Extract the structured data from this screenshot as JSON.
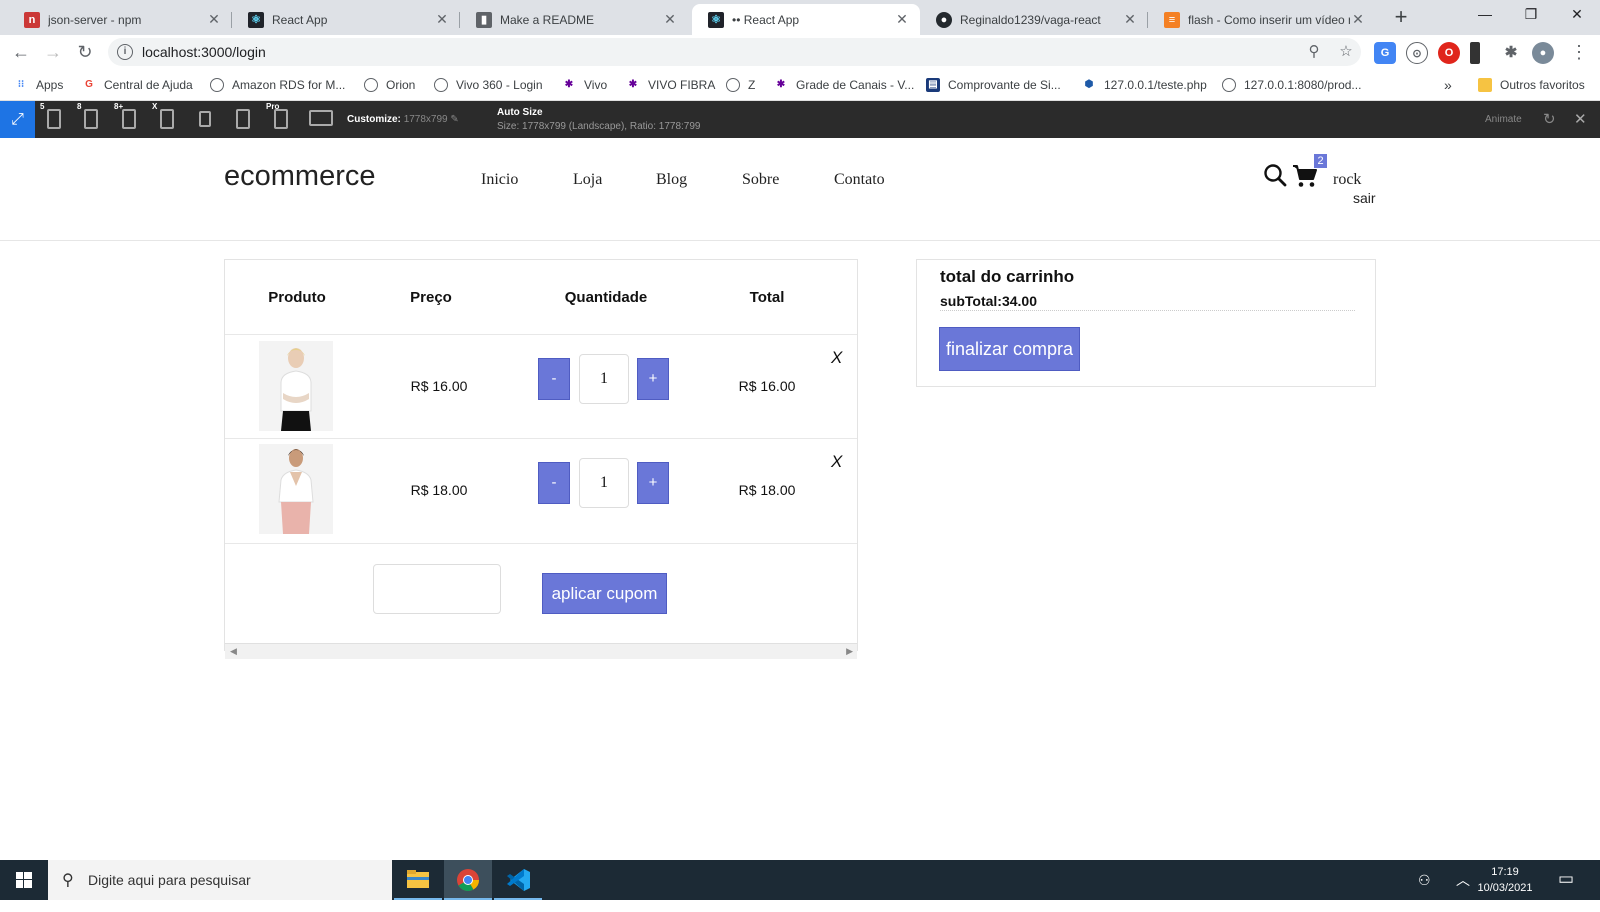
{
  "browser": {
    "tabs": [
      {
        "title": "json-server - npm",
        "icon": "npm-icon",
        "color": "#cb3837"
      },
      {
        "title": "React App",
        "icon": "react-icon",
        "color": "#20232a"
      },
      {
        "title": "Make a README",
        "icon": "document-icon",
        "color": "#5f6368"
      },
      {
        "title": "•• React App",
        "icon": "react-icon",
        "color": "#20232a"
      },
      {
        "title": "Reginaldo1239/vaga-react",
        "icon": "github-icon",
        "color": "#24292e"
      },
      {
        "title": "flash - Como inserir um vídeo n",
        "icon": "stackoverflow-icon",
        "color": "#f48024"
      }
    ],
    "url": "localhost:3000/login",
    "bookmarks": [
      "Apps",
      "Central de Ajuda",
      "Amazon RDS for M...",
      "Orion",
      "Vivo 360 - Login",
      "Vivo",
      "VIVO FIBRA",
      "Z",
      "Grade de Canais - V...",
      "Comprovante de Si...",
      "127.0.0.1/teste.php",
      "127.0.0.1:8080/prod...",
      "Outros favoritos"
    ]
  },
  "resizer": {
    "device_labels": [
      "5",
      "8",
      "8+",
      "X",
      "Pro"
    ],
    "customize_label": "Customize:",
    "customize_value": "1778x799",
    "auto_size_label": "Auto Size",
    "auto_size_detail": "Size: 1778x799 (Landscape), Ratio: 1778:799",
    "animate_label": "Animate"
  },
  "site": {
    "logo": "ecommerce",
    "nav": [
      "Inicio",
      "Loja",
      "Blog",
      "Sobre",
      "Contato"
    ],
    "cart_count": "2",
    "user": "rock",
    "logout": "sair"
  },
  "cart": {
    "headers": {
      "product": "Produto",
      "price": "Preço",
      "quantity": "Quantidade",
      "total": "Total"
    },
    "items": [
      {
        "price": "R$ 16.00",
        "quantity": "1",
        "total": "R$ 16.00",
        "minus": "-",
        "plus": "+",
        "remove": "X"
      },
      {
        "price": "R$ 18.00",
        "quantity": "1",
        "total": "R$ 18.00",
        "minus": "-",
        "plus": "+",
        "remove": "X"
      }
    ],
    "coupon_button": "aplicar cupom"
  },
  "totals": {
    "title": "total do carrinho",
    "subtotal": "subTotal:34.00",
    "checkout_button": "finalizar compra"
  },
  "taskbar": {
    "search_placeholder": "Digite aqui para pesquisar",
    "time": "17:19",
    "date": "10/03/2021"
  },
  "colors": {
    "accent": "#6a77d8",
    "taskbar": "#1c2a35",
    "resizer_bar": "#2b2b2b"
  }
}
